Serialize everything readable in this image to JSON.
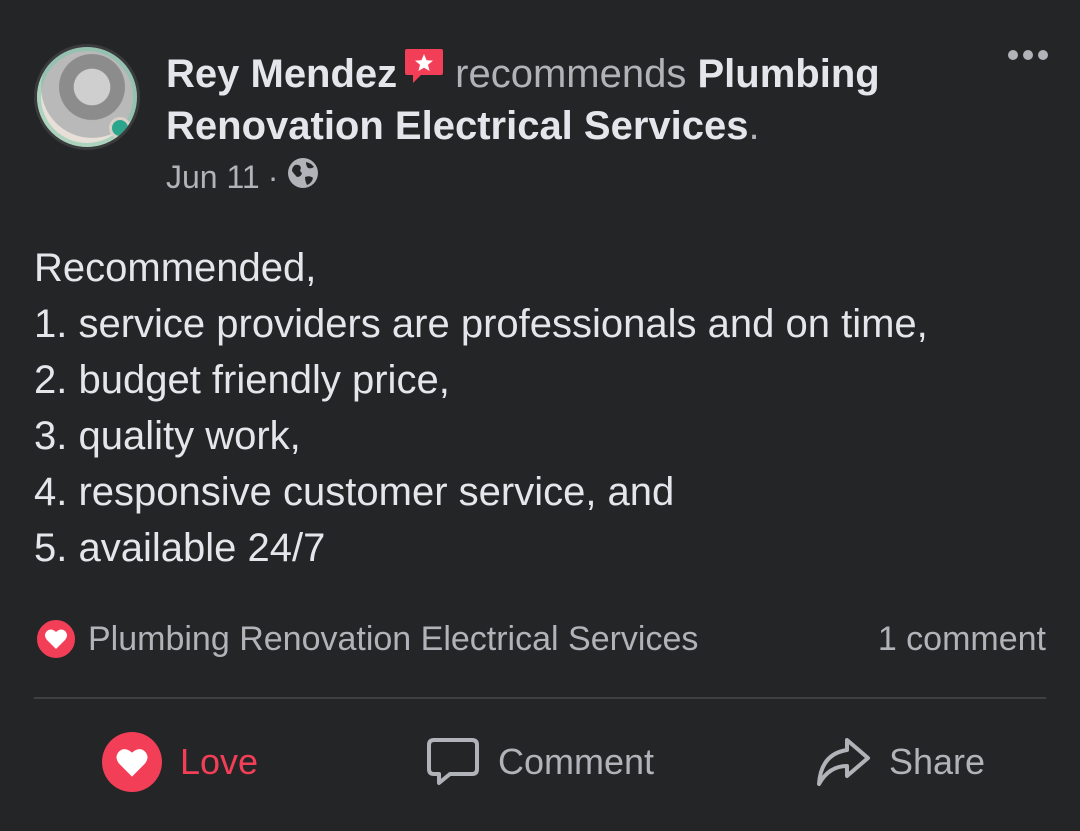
{
  "post": {
    "author_name": "Rey Mendez",
    "verb": "recommends",
    "page_name": "Plumbing Renovation Electrical Services",
    "trailing_period": ".",
    "date": "Jun 11",
    "meta_separator": "·",
    "privacy_icon": "globe-icon",
    "body_lines": [
      "Recommended,",
      "1. service providers are professionals and on time,",
      "2. budget friendly price,",
      "3. quality work,",
      "4. responsive customer service, and",
      "5. available 24/7"
    ]
  },
  "summary": {
    "reaction_icon": "love-reaction-icon",
    "reactor": "Plumbing Renovation Electrical Services",
    "comments": "1 comment"
  },
  "actions": {
    "love_label": "Love",
    "comment_label": "Comment",
    "share_label": "Share"
  },
  "colors": {
    "background": "#242526",
    "text": "#e4e6eb",
    "secondary": "#b0b3b8",
    "love": "#f33e58"
  }
}
